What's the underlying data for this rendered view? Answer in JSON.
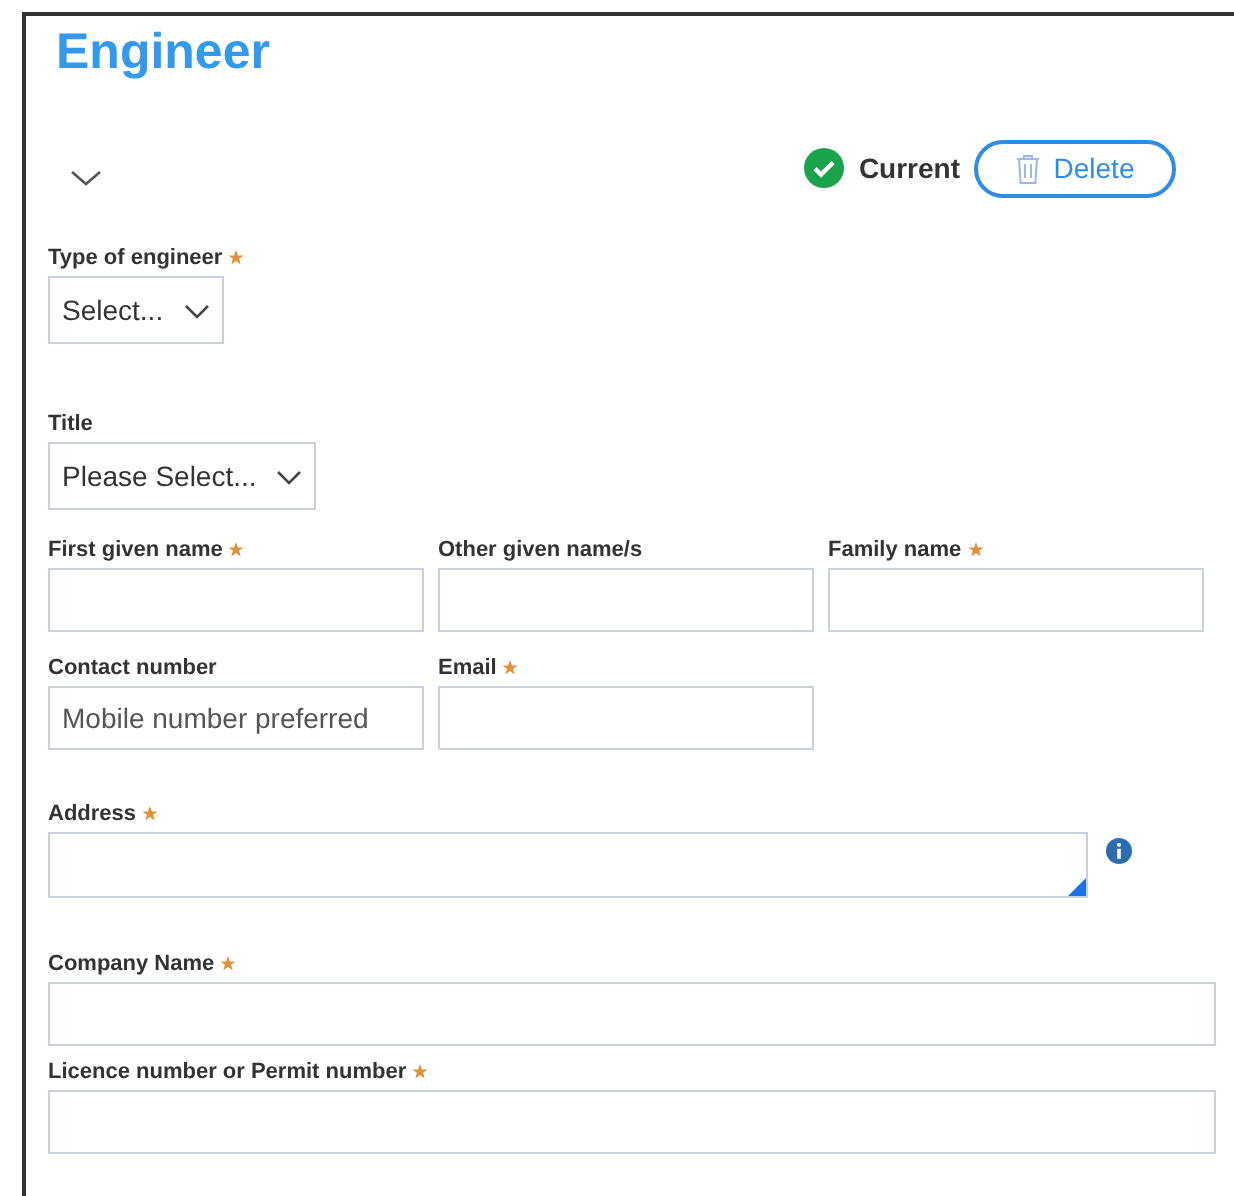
{
  "heading": "Engineer",
  "status": {
    "label": "Current"
  },
  "delete_button": {
    "label": "Delete"
  },
  "rows": [
    {
      "fields": [
        {
          "kind": "dropdown",
          "label": "Type of engineer",
          "required": true,
          "value": "Select..."
        }
      ]
    },
    {
      "fields": [
        {
          "kind": "dropdown",
          "label": "Title",
          "required": false,
          "value": "Please Select..."
        }
      ]
    },
    {
      "fields": [
        {
          "kind": "text",
          "label": "First given name",
          "required": true
        },
        {
          "kind": "text",
          "label": "Other given name/s",
          "required": false
        },
        {
          "kind": "text",
          "label": "Family name",
          "required": true
        }
      ]
    },
    {
      "fields": [
        {
          "kind": "text",
          "label": "Contact number",
          "required": false,
          "placeholder": "Mobile number preferred"
        },
        {
          "kind": "text",
          "label": "Email",
          "required": true
        }
      ]
    },
    {
      "fields": [
        {
          "kind": "textarea",
          "label": "Address",
          "required": true
        }
      ]
    },
    {
      "fields": [
        {
          "kind": "text",
          "label": "Company Name",
          "required": true
        }
      ]
    },
    {
      "fields": [
        {
          "kind": "text",
          "label": "Licence number or Permit number",
          "required": true
        }
      ]
    }
  ]
}
